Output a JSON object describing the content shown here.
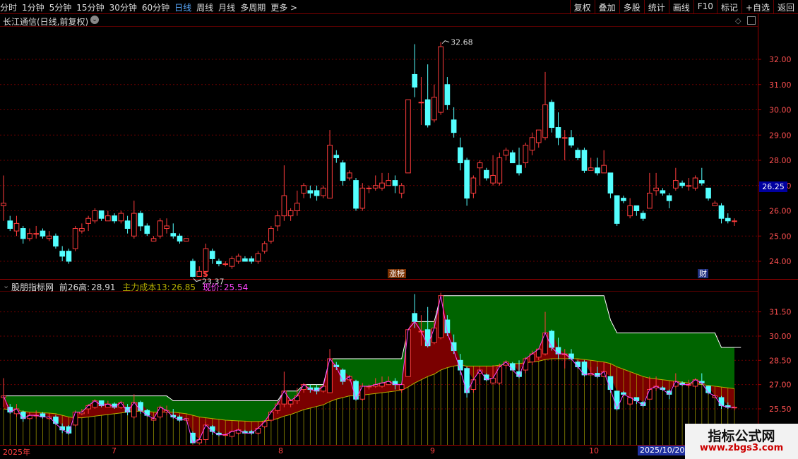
{
  "toolbar": {
    "periods": [
      "分时",
      "1分钟",
      "5分钟",
      "15分钟",
      "30分钟",
      "60分钟",
      "日线",
      "周线",
      "月线",
      "多周期",
      "更多 >"
    ],
    "active_index": 6,
    "actions": [
      "复权",
      "叠加",
      "多股",
      "统计",
      "画线",
      "F10",
      "标记",
      "+自选",
      "返回"
    ]
  },
  "stock": {
    "name": "长江通信(日线,前复权)"
  },
  "price_axis": {
    "labels": [
      "32.00",
      "31.00",
      "30.00",
      "29.00",
      "28.00",
      "27.00",
      "26.00",
      "25.00",
      "24.00"
    ],
    "current": "26.25"
  },
  "annotations": {
    "high": "32.68",
    "low": "23.37",
    "s_marker": "S",
    "tag_zb": "涨榜",
    "tag_cai": "财"
  },
  "indicator": {
    "name": "股朋指标网",
    "prev_high_label": "前26高:",
    "prev_high_value": "28.91",
    "cost_label": "主力成本13:",
    "cost_value": "26.85",
    "price_label": "现价:",
    "price_value": "25.54",
    "axis_labels": [
      "31.50",
      "30.00",
      "28.50",
      "27.00",
      "25.50"
    ]
  },
  "date_axis": {
    "labels": [
      "2025年",
      "7",
      "8",
      "9",
      "10"
    ],
    "cursor_date": "2025/10/20"
  },
  "watermark": {
    "title": "指标公式网",
    "url": "www.zbgs3.com"
  },
  "colors": {
    "up": "#ff3c3c",
    "down": "#54ffff",
    "bg": "#000000",
    "grid": "#7a0000",
    "fill_green": "#006400",
    "fill_red": "#7a0000",
    "cost_line": "#b5b000",
    "price_line": "#ff44ff"
  },
  "chart_data": {
    "type": "candlestick",
    "price_range": [
      23.2,
      32.8
    ],
    "indicator_range": [
      24.8,
      32.0
    ],
    "candles": [
      [
        26.2,
        26.3,
        25.6,
        27.4
      ],
      [
        25.6,
        25.3,
        25.2,
        25.8
      ],
      [
        25.2,
        25.5,
        25.0,
        25.8
      ],
      [
        25.3,
        24.9,
        24.7,
        25.4
      ],
      [
        24.9,
        25.1,
        24.8,
        25.3
      ],
      [
        25.1,
        25.1,
        24.9,
        25.4
      ],
      [
        25.2,
        25.0,
        24.9,
        25.3
      ],
      [
        24.9,
        25.0,
        24.8,
        25.2
      ],
      [
        25.0,
        24.6,
        24.5,
        25.1
      ],
      [
        24.4,
        24.2,
        24.0,
        24.6
      ],
      [
        24.4,
        24.0,
        23.9,
        24.5
      ],
      [
        24.5,
        25.3,
        24.4,
        25.4
      ],
      [
        25.2,
        25.3,
        25.1,
        25.5
      ],
      [
        25.5,
        25.7,
        25.2,
        25.8
      ],
      [
        25.6,
        26.0,
        25.5,
        26.1
      ],
      [
        26.0,
        25.7,
        25.6,
        26.0
      ],
      [
        25.6,
        25.8,
        25.6,
        26.0
      ],
      [
        25.8,
        25.6,
        25.5,
        25.9
      ],
      [
        25.6,
        25.9,
        25.5,
        26.0
      ],
      [
        25.6,
        25.3,
        25.1,
        25.8
      ],
      [
        25.0,
        25.9,
        24.9,
        26.4
      ],
      [
        25.9,
        25.4,
        25.2,
        26.0
      ],
      [
        25.4,
        25.1,
        25.0,
        25.5
      ],
      [
        24.8,
        24.9,
        24.8,
        25.0
      ],
      [
        25.0,
        25.6,
        24.9,
        25.7
      ],
      [
        25.3,
        25.4,
        25.1,
        25.7
      ],
      [
        25.1,
        25.0,
        24.9,
        25.5
      ],
      [
        25.0,
        24.8,
        24.7,
        25.1
      ],
      [
        24.8,
        24.9,
        24.8,
        24.9
      ],
      [
        24.0,
        23.4,
        23.37,
        24.1
      ],
      [
        23.4,
        23.6,
        23.4,
        23.8
      ],
      [
        23.6,
        24.5,
        23.4,
        24.7
      ],
      [
        24.4,
        24.1,
        23.9,
        24.5
      ],
      [
        24.0,
        23.9,
        23.8,
        24.1
      ],
      [
        23.9,
        23.9,
        23.8,
        24.0
      ],
      [
        23.8,
        24.1,
        23.7,
        24.2
      ],
      [
        24.0,
        24.2,
        23.9,
        24.3
      ],
      [
        24.1,
        24.0,
        24.0,
        24.2
      ],
      [
        24.1,
        24.0,
        23.9,
        24.2
      ],
      [
        24.0,
        24.3,
        23.9,
        24.4
      ],
      [
        24.4,
        24.7,
        24.3,
        24.8
      ],
      [
        24.8,
        25.3,
        24.7,
        25.4
      ],
      [
        25.4,
        25.8,
        25.2,
        26.0
      ],
      [
        25.8,
        26.6,
        25.6,
        27.8
      ],
      [
        25.8,
        26.0,
        25.6,
        26.1
      ],
      [
        26.0,
        26.3,
        25.8,
        26.8
      ],
      [
        26.7,
        27.0,
        26.5,
        27.1
      ],
      [
        26.8,
        26.7,
        26.5,
        27.0
      ],
      [
        26.8,
        26.6,
        26.4,
        27.0
      ],
      [
        26.6,
        26.9,
        26.5,
        27.0
      ],
      [
        26.5,
        28.6,
        26.5,
        29.2
      ],
      [
        28.2,
        28.1,
        27.9,
        28.4
      ],
      [
        27.9,
        27.2,
        27.0,
        28.0
      ],
      [
        27.3,
        27.5,
        27.2,
        27.6
      ],
      [
        27.2,
        26.1,
        26.0,
        27.3
      ],
      [
        26.1,
        26.9,
        26.0,
        27.1
      ],
      [
        26.9,
        26.9,
        26.7,
        27.0
      ],
      [
        26.9,
        27.0,
        26.8,
        27.4
      ],
      [
        26.9,
        27.1,
        26.8,
        27.5
      ],
      [
        27.0,
        27.2,
        27.0,
        27.5
      ],
      [
        27.2,
        27.0,
        26.7,
        27.4
      ],
      [
        26.7,
        27.0,
        26.5,
        27.1
      ],
      [
        27.5,
        30.4,
        27.5,
        30.4
      ],
      [
        31.4,
        30.9,
        30.5,
        32.6
      ],
      [
        30.3,
        30.3,
        29.4,
        31.3
      ],
      [
        30.4,
        29.4,
        29.3,
        31.8
      ],
      [
        29.6,
        30.5,
        29.5,
        31.0
      ],
      [
        29.9,
        32.5,
        29.8,
        32.68
      ],
      [
        31.0,
        30.2,
        30.0,
        31.3
      ],
      [
        29.6,
        29.1,
        28.9,
        30.1
      ],
      [
        28.5,
        27.9,
        27.6,
        28.9
      ],
      [
        28.0,
        26.5,
        26.2,
        28.1
      ],
      [
        26.7,
        27.3,
        26.5,
        27.4
      ],
      [
        27.7,
        27.9,
        27.0,
        28.0
      ],
      [
        27.6,
        27.3,
        27.2,
        27.7
      ],
      [
        27.1,
        27.4,
        27.0,
        28.2
      ],
      [
        27.1,
        28.1,
        27.0,
        28.3
      ],
      [
        28.2,
        28.4,
        28.0,
        28.5
      ],
      [
        28.3,
        27.9,
        27.9,
        28.4
      ],
      [
        27.8,
        27.5,
        27.4,
        28.5
      ],
      [
        27.9,
        28.6,
        27.7,
        28.7
      ],
      [
        28.4,
        28.9,
        28.2,
        29.1
      ],
      [
        28.7,
        29.2,
        28.5,
        29.2
      ],
      [
        28.9,
        30.2,
        28.8,
        31.5
      ],
      [
        30.3,
        29.3,
        29.1,
        30.4
      ],
      [
        29.3,
        28.9,
        28.6,
        29.9
      ],
      [
        28.9,
        28.9,
        28.0,
        29.2
      ],
      [
        28.9,
        28.6,
        28.5,
        29.2
      ],
      [
        28.4,
        28.1,
        28.0,
        28.5
      ],
      [
        28.4,
        27.6,
        27.5,
        28.5
      ],
      [
        27.6,
        27.7,
        27.6,
        28.1
      ],
      [
        27.7,
        27.5,
        27.4,
        28.1
      ],
      [
        27.5,
        27.8,
        27.5,
        28.4
      ],
      [
        27.5,
        26.7,
        26.5,
        27.5
      ],
      [
        26.6,
        25.5,
        25.4,
        26.6
      ],
      [
        26.5,
        26.4,
        26.3,
        26.6
      ],
      [
        25.8,
        26.2,
        25.7,
        26.5
      ],
      [
        26.2,
        26.0,
        25.8,
        26.2
      ],
      [
        25.9,
        25.7,
        25.6,
        26.0
      ],
      [
        26.1,
        26.7,
        26.1,
        27.5
      ],
      [
        26.8,
        26.9,
        26.6,
        27.5
      ],
      [
        26.8,
        26.7,
        26.6,
        26.9
      ],
      [
        26.6,
        26.4,
        26.1,
        26.7
      ],
      [
        26.9,
        27.2,
        26.8,
        27.7
      ],
      [
        27.1,
        27.0,
        26.9,
        27.2
      ],
      [
        27.0,
        27.0,
        26.8,
        27.3
      ],
      [
        26.9,
        27.3,
        26.8,
        27.4
      ],
      [
        27.2,
        27.1,
        27.0,
        27.7
      ],
      [
        26.9,
        26.5,
        26.4,
        26.9
      ],
      [
        26.2,
        26.3,
        26.2,
        26.4
      ],
      [
        26.2,
        25.7,
        25.5,
        26.3
      ],
      [
        25.7,
        25.6,
        25.5,
        25.9
      ],
      [
        25.6,
        25.6,
        25.4,
        25.7
      ]
    ],
    "prev26_high": [
      26.3,
      26.3,
      26.3,
      26.3,
      26.3,
      26.3,
      26.3,
      26.3,
      26.3,
      26.3,
      26.3,
      26.3,
      26.3,
      26.3,
      26.3,
      26.3,
      26.3,
      26.3,
      26.3,
      26.3,
      26.3,
      26.3,
      26.3,
      26.3,
      26.3,
      26.3,
      26.0,
      26.0,
      26.0,
      26.0,
      26.0,
      26.0,
      26.0,
      26.0,
      26.0,
      26.0,
      26.0,
      26.0,
      26.0,
      26.0,
      26.0,
      26.0,
      26.0,
      26.6,
      26.6,
      26.6,
      27.0,
      27.0,
      27.0,
      27.0,
      28.6,
      28.6,
      28.6,
      28.6,
      28.6,
      28.6,
      28.6,
      28.6,
      28.6,
      28.6,
      28.6,
      28.6,
      30.4,
      30.9,
      30.9,
      30.9,
      30.9,
      32.5,
      32.5,
      32.5,
      32.5,
      32.5,
      32.5,
      32.5,
      32.5,
      32.5,
      32.5,
      32.5,
      32.5,
      32.5,
      32.5,
      32.5,
      32.5,
      32.5,
      32.5,
      32.5,
      32.5,
      32.5,
      32.5,
      32.5,
      32.5,
      32.5,
      32.5,
      31.0,
      30.2,
      30.2,
      30.2,
      30.2,
      30.2,
      30.2,
      30.2,
      30.2,
      30.2,
      30.2,
      30.2,
      30.2,
      30.2,
      30.2,
      30.2,
      30.2,
      29.3,
      29.3,
      29.3,
      29.3
    ],
    "main_cost": [
      25.5,
      25.45,
      25.4,
      25.35,
      25.3,
      25.28,
      25.26,
      25.24,
      25.2,
      25.1,
      25.0,
      24.95,
      24.95,
      25.0,
      25.05,
      25.1,
      25.15,
      25.2,
      25.25,
      25.3,
      25.35,
      25.35,
      25.35,
      25.3,
      25.3,
      25.3,
      25.3,
      25.25,
      25.2,
      25.1,
      25.0,
      24.95,
      24.9,
      24.85,
      24.8,
      24.78,
      24.76,
      24.74,
      24.72,
      24.72,
      24.75,
      24.8,
      24.9,
      25.05,
      25.15,
      25.3,
      25.45,
      25.55,
      25.65,
      25.75,
      25.95,
      26.1,
      26.2,
      26.3,
      26.3,
      26.35,
      26.4,
      26.45,
      26.5,
      26.55,
      26.6,
      26.65,
      26.85,
      27.1,
      27.3,
      27.5,
      27.65,
      27.9,
      28.05,
      28.15,
      28.2,
      28.15,
      28.15,
      28.15,
      28.15,
      28.15,
      28.2,
      28.25,
      28.3,
      28.3,
      28.35,
      28.4,
      28.45,
      28.55,
      28.6,
      28.6,
      28.6,
      28.6,
      28.6,
      28.55,
      28.5,
      28.45,
      28.4,
      28.3,
      28.1,
      27.95,
      27.8,
      27.65,
      27.5,
      27.4,
      27.35,
      27.3,
      27.25,
      27.2,
      27.15,
      27.1,
      27.05,
      27.0,
      26.95,
      26.9,
      26.85,
      26.8,
      26.75
    ]
  }
}
